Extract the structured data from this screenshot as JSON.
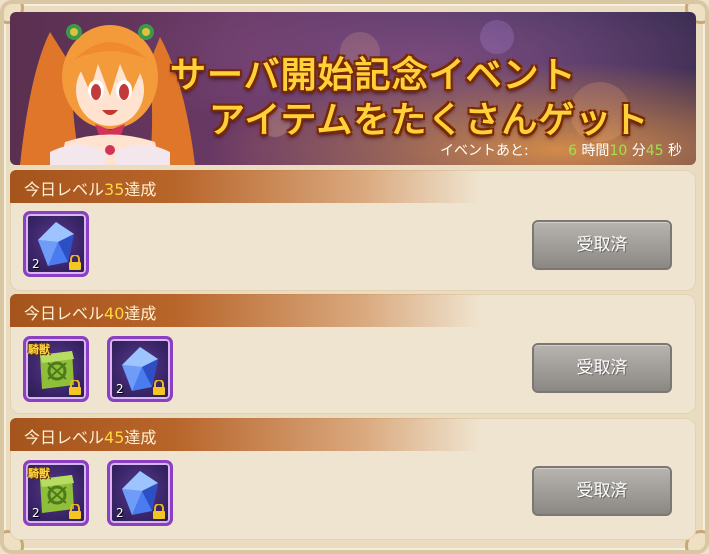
{
  "banner": {
    "title_line1": "サーバ開始記念イベント",
    "title_line2": "アイテムをたくさんゲット",
    "timer_label": "イベントあと:",
    "hours": "6",
    "hours_unit": "時間",
    "minutes": "10",
    "minutes_unit": "分",
    "seconds": "45",
    "seconds_unit": "秒"
  },
  "colors": {
    "accent_gold": "#ffd23a",
    "header_brown": "#a5541d",
    "frame_purple": "#8b3fc2",
    "button_gray": "#9f9c97",
    "timer_green": "#9fe34d"
  },
  "rewards": [
    {
      "title_prefix": "今日レベル",
      "level": "35",
      "title_suffix": "達成",
      "items": [
        {
          "icon": "blue-crystal-icon",
          "count": "2",
          "tag": ""
        }
      ],
      "button_label": "受取済"
    },
    {
      "title_prefix": "今日レベル",
      "level": "40",
      "title_suffix": "達成",
      "items": [
        {
          "icon": "mount-rune-icon",
          "count": "",
          "tag": "騎獣"
        },
        {
          "icon": "blue-crystal-icon",
          "count": "2",
          "tag": ""
        }
      ],
      "button_label": "受取済"
    },
    {
      "title_prefix": "今日レベル",
      "level": "45",
      "title_suffix": "達成",
      "items": [
        {
          "icon": "mount-rune-icon",
          "count": "2",
          "tag": "騎獣"
        },
        {
          "icon": "blue-crystal-icon",
          "count": "2",
          "tag": ""
        }
      ],
      "button_label": "受取済"
    }
  ]
}
